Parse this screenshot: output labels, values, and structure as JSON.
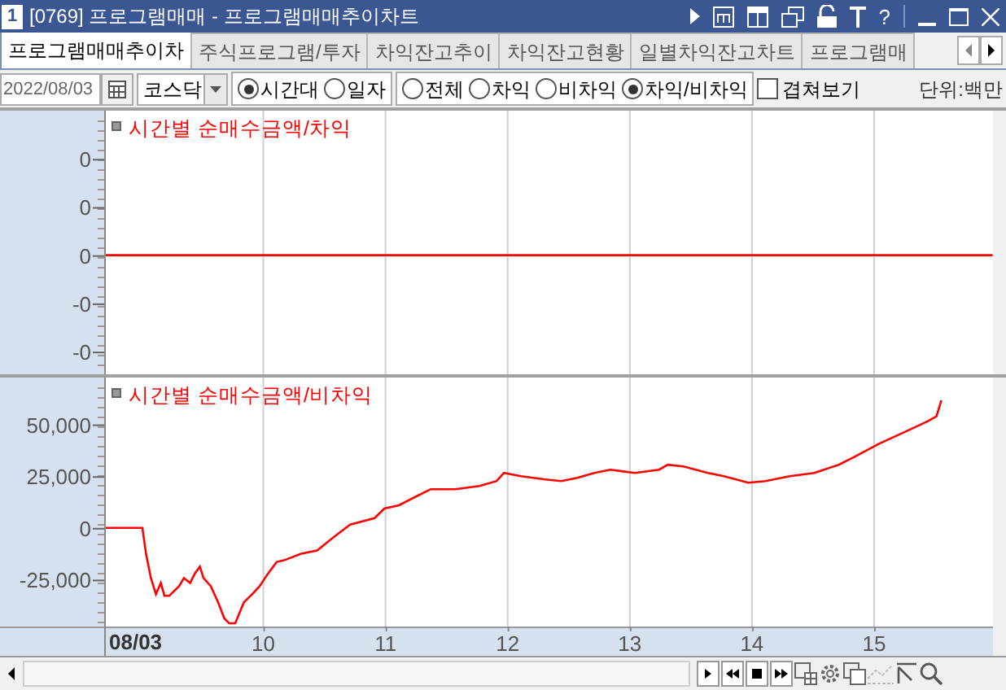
{
  "window": {
    "badge": "1",
    "title": "[0769] 프로그램매매 - 프로그램매매추이차트",
    "help": "?"
  },
  "tabs": [
    {
      "label": "프로그램매매추이차",
      "selected": true
    },
    {
      "label": "주식프로그램/투자",
      "selected": false
    },
    {
      "label": "차익잔고추이",
      "selected": false
    },
    {
      "label": "차익잔고현황",
      "selected": false
    },
    {
      "label": "일별차익잔고차트",
      "selected": false
    },
    {
      "label": "프로그램매",
      "selected": false
    }
  ],
  "toolbar": {
    "date": "2022/08/03",
    "market": "코스닥",
    "period": [
      {
        "label": "시간대",
        "selected": true
      },
      {
        "label": "일자",
        "selected": false
      }
    ],
    "type": [
      {
        "label": "전체",
        "selected": false
      },
      {
        "label": "차익",
        "selected": false
      },
      {
        "label": "비차익",
        "selected": false
      },
      {
        "label": "차익/비차익",
        "selected": true
      }
    ],
    "overlay": {
      "label": "겹쳐보기",
      "checked": false
    },
    "unit": "단위:백만"
  },
  "charts": [
    {
      "chart_data": {
        "type": "line",
        "title": "시간별 순매수금액/차익",
        "grid": true,
        "xlim": [
          7.844,
          15.973
        ],
        "ylim": [
          -0.247,
          0.3
        ],
        "yticks": [
          {
            "value": 0.2,
            "label": "0"
          },
          {
            "value": 0.1,
            "label": "0"
          },
          {
            "value": 0,
            "label": "0"
          },
          {
            "value": -0.1,
            "label": "-0"
          },
          {
            "value": -0.2,
            "label": "-0"
          }
        ],
        "x": [
          8.71,
          15.97
        ],
        "series": [
          {
            "color": "#ff0000",
            "values": [
              0,
              0
            ]
          }
        ]
      }
    },
    {
      "date_label": "08/03",
      "chart_data": {
        "type": "line",
        "title": "시간별 순매수금액/비차익",
        "grid": true,
        "xlim": [
          7.844,
          15.973
        ],
        "ylim": [
          -47656,
          72656
        ],
        "yticks": [
          {
            "value": 50000,
            "label": "50,000"
          },
          {
            "value": 25000,
            "label": "25,000"
          },
          {
            "value": 0,
            "label": "0"
          },
          {
            "value": -25000,
            "label": "-25,000"
          }
        ],
        "xticks": [
          {
            "value": 10,
            "label": "10"
          },
          {
            "value": 11,
            "label": "11"
          },
          {
            "value": 12,
            "label": "12"
          },
          {
            "value": 13,
            "label": "13"
          },
          {
            "value": 14,
            "label": "14"
          },
          {
            "value": 15,
            "label": "15"
          }
        ],
        "x": [
          8.71,
          9.01,
          9.04,
          9.08,
          9.12,
          9.16,
          9.19,
          9.23,
          9.31,
          9.35,
          9.4,
          9.44,
          9.48,
          9.51,
          9.57,
          9.63,
          9.68,
          9.72,
          9.77,
          9.84,
          9.91,
          9.97,
          10.04,
          10.11,
          10.17,
          10.31,
          10.44,
          10.57,
          10.71,
          10.91,
          10.99,
          11.11,
          11.24,
          11.37,
          11.57,
          11.77,
          11.91,
          11.97,
          12.11,
          12.31,
          12.44,
          12.57,
          12.71,
          12.84,
          13.04,
          13.24,
          13.31,
          13.44,
          13.64,
          13.77,
          13.97,
          14.11,
          14.31,
          14.51,
          14.71,
          14.84,
          15.04,
          15.24,
          15.44,
          15.51,
          15.55
        ],
        "series": [
          {
            "color": "#ff0000",
            "values": [
              0,
              0,
              -12500,
              -24219,
              -32031,
              -26563,
              -32813,
              -32813,
              -28125,
              -24219,
              -26563,
              -21875,
              -18750,
              -24219,
              -28125,
              -35938,
              -43750,
              -46094,
              -46094,
              -35938,
              -32031,
              -28125,
              -21875,
              -16406,
              -15625,
              -12500,
              -10938,
              -4688,
              1563,
              4688,
              9375,
              10938,
              14844,
              18750,
              18750,
              20313,
              22656,
              26563,
              25000,
              23438,
              22656,
              24219,
              26563,
              28125,
              26563,
              28125,
              30469,
              29688,
              26563,
              25000,
              21875,
              22656,
              25000,
              26563,
              30469,
              34375,
              40625,
              46094,
              51563,
              53906,
              61719
            ]
          }
        ]
      }
    }
  ]
}
